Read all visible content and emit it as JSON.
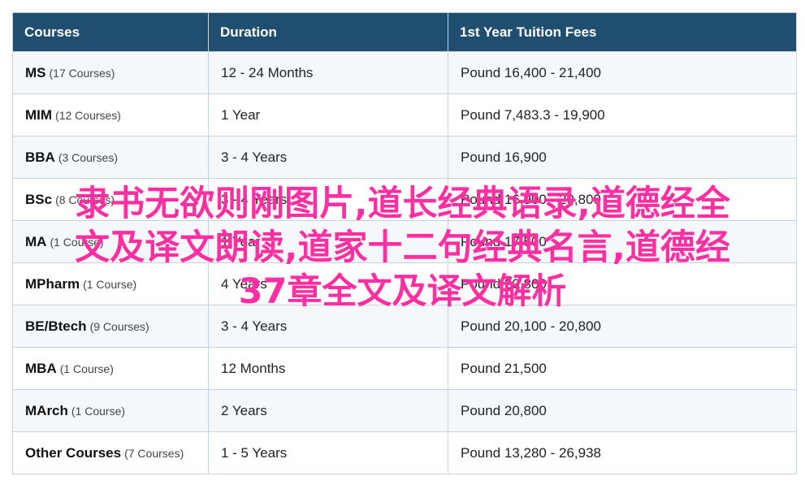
{
  "table": {
    "headers": [
      "Courses",
      "Duration",
      "1st Year Tuition Fees"
    ],
    "rows": [
      {
        "name": "MS",
        "count": "(17 Courses)",
        "duration": "12 - 24 Months",
        "fee": "Pound 16,400 - 21,400"
      },
      {
        "name": "MIM",
        "count": "(12 Courses)",
        "duration": "1 Year",
        "fee": "Pound 7,483.3 - 19,900"
      },
      {
        "name": "BBA",
        "count": "(3 Courses)",
        "duration": "3 - 4 Years",
        "fee": "Pound 16,900"
      },
      {
        "name": "BSc",
        "count": "(8 Courses)",
        "duration": "3 - 4 Years",
        "fee": "Pound 16,900 - 20,800"
      },
      {
        "name": "MA",
        "count": "(1 Course)",
        "duration": "1 Year",
        "fee": "Pound 17,500"
      },
      {
        "name": "MPharm",
        "count": "(1 Course)",
        "duration": "4 Years",
        "fee": "Pound 20,800"
      },
      {
        "name": "BE/Btech",
        "count": "(9 Courses)",
        "duration": "3 - 4 Years",
        "fee": "Pound 20,100 - 20,800"
      },
      {
        "name": "MBA",
        "count": "(1 Course)",
        "duration": "12 Months",
        "fee": "Pound 21,500"
      },
      {
        "name": "MArch",
        "count": "(1 Course)",
        "duration": "2 Years",
        "fee": "Pound 20,800"
      },
      {
        "name": "Other Courses",
        "count": "(7 Courses)",
        "duration": "1 - 5 Years",
        "fee": "Pound 13,280 - 26,938"
      }
    ]
  },
  "overlay": {
    "line1": "隶书无欲则刚图片,道长经典语录,道德经全",
    "line2": "文及译文朗读,道家十二句经典名言,道德经",
    "line3": "37章全文及译文解析"
  },
  "colors": {
    "header_bg": "#1f4e6e",
    "overlay_text": "#ff2fa1",
    "row_alt_bg": "#f4f8fb"
  }
}
